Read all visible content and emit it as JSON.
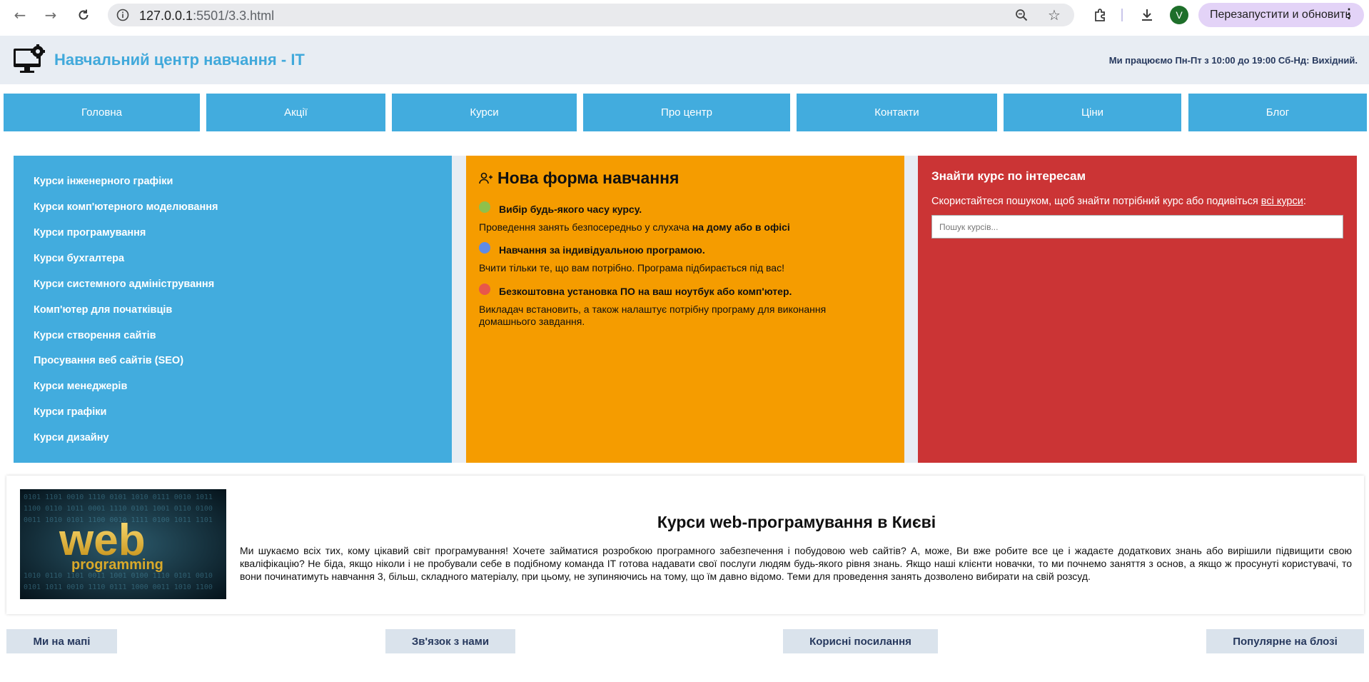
{
  "browser": {
    "url_host": "127.0.0.1",
    "url_rest": ":5501/3.3.html",
    "profile_initial": "V",
    "relaunch_label": "Перезапустити и обновить"
  },
  "header": {
    "title": "Навчальний центр навчання - IT",
    "hours": "Ми працюємо Пн-Пт з 10:00 до 19:00 Сб-Нд: Вихідний."
  },
  "menu": [
    "Головна",
    "Акції",
    "Курси",
    "Про центр",
    "Контакти",
    "Ціни",
    "Блог"
  ],
  "courses": [
    "Курси інженерного графіки",
    "Курси комп'ютерного моделювання",
    "Курси програмування",
    "Курси бухгалтера",
    "Курси системного адміністрування",
    "Комп'ютер для початківців",
    "Курси створення сайтів",
    "Просування веб сайтів (SEO)",
    "Курси менеджерів",
    "Курси графіки",
    "Курси дизайну"
  ],
  "new_form": {
    "title": "Нова форма навчання",
    "features": [
      {
        "heading": "Вибір будь-якого часу курсу.",
        "text_plain": "Проведення занять безпосередньо у слухача ",
        "text_bold": "на дому або в офісі",
        "color": "#8fc04b"
      },
      {
        "heading": "Навчання за індивідуальною програмою.",
        "text_plain": "Вчити тільки те, що вам потрібно. Програма підбирається під вас!",
        "text_bold": "",
        "color": "#5f8be6"
      },
      {
        "heading": "Безкоштовна установка ПО на ваш ноутбук або комп'ютер.",
        "text_plain": "Викладач встановить, а також налаштує потрібну програму для виконання домашнього завдання.",
        "text_bold": "",
        "color": "#e8574a"
      }
    ]
  },
  "search": {
    "title": "Знайти курс по інтересам",
    "text_before": "Скористайтеся пошуком, щоб знайти потрібний курс або подивіться ",
    "link": "всі курси",
    "text_after": ":",
    "placeholder": "Пошук курсів..."
  },
  "info": {
    "image_word_1": "web",
    "image_word_2": "programming",
    "title": "Курси web-програмування в Києві",
    "text": "Ми шукаємо всіх тих, кому цікавий світ програмування! Хочете займатися розробкою програмного забезпечення і побудовою web сайтів? А, може, Ви вже робите все це і жадаєте додаткових знань або вирішили підвищити свою кваліфікацію? Не біда, якщо ніколи і не пробували себе в подібному команда IT готова надавати свої послуги людям будь-якого рівня знань. Якщо наші клієнти новачки, то ми почнемо заняття з основ, а якщо ж просунуті користувачі, то вони починатимуть навчання 3, більш, складного матеріалу, при цьому, не зупиняючись на тому, що їм давно відомо. Теми для проведення занять дозволено вибирати на свій розсуд."
  },
  "footer": [
    "Ми на мапі",
    "Зв'язок з нами",
    "Корисні посилання",
    "Популярне на блозі"
  ]
}
